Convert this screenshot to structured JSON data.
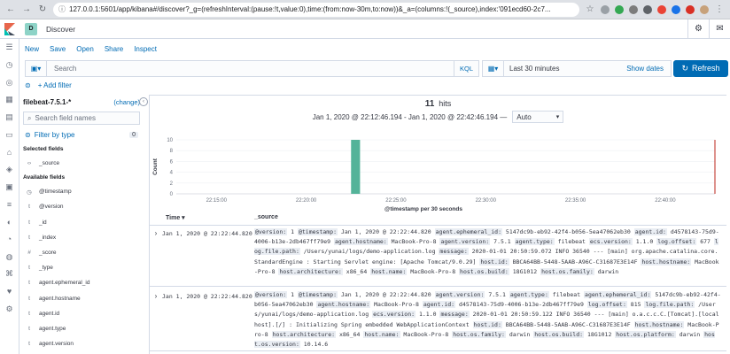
{
  "browser": {
    "url": "127.0.0.1:5601/app/kibana#/discover?_g=(refreshInterval:(pause:!t,value:0),time:(from:now-30m,to:now))&_a=(columns:!(_source),index:'091ecd60-2c7..."
  },
  "header": {
    "space_letter": "D",
    "breadcrumb": "Discover"
  },
  "top_menu": [
    "New",
    "Save",
    "Open",
    "Share",
    "Inspect"
  ],
  "query": {
    "placeholder": "Search",
    "kql": "KQL",
    "range": "Last 30 minutes",
    "show_dates": "Show dates",
    "refresh": "Refresh"
  },
  "filter": {
    "add": "+ Add filter"
  },
  "sidebar": {
    "index_pattern": "filebeat-7.5.1-*",
    "change": "(change)",
    "search_placeholder": "Search field names",
    "filter_by_type": "Filter by type",
    "filter_count": "0",
    "selected_heading": "Selected fields",
    "selected": [
      {
        "type": "‹›",
        "name": "_source"
      }
    ],
    "available_heading": "Available fields",
    "available": [
      {
        "type": "◷",
        "name": "@timestamp"
      },
      {
        "type": "t",
        "name": "@version"
      },
      {
        "type": "t",
        "name": "_id"
      },
      {
        "type": "t",
        "name": "_index"
      },
      {
        "type": "#",
        "name": "_score"
      },
      {
        "type": "t",
        "name": "_type"
      },
      {
        "type": "t",
        "name": "agent.ephemeral_id"
      },
      {
        "type": "t",
        "name": "agent.hostname"
      },
      {
        "type": "t",
        "name": "agent.id"
      },
      {
        "type": "t",
        "name": "agent.type"
      },
      {
        "type": "t",
        "name": "agent.version"
      }
    ]
  },
  "results": {
    "hits_count": "11",
    "hits_label": "hits",
    "time_range": "Jan 1, 2020 @ 22:12:46.194 - Jan 1, 2020 @ 22:42:46.194 —",
    "interval": "Auto"
  },
  "chart_data": {
    "type": "bar",
    "xlabel": "@timestamp per 30 seconds",
    "ylabel": "Count",
    "ylim": [
      0,
      10
    ],
    "yticks": [
      0,
      2,
      4,
      6,
      8,
      10
    ],
    "xticks": [
      "22:15:00",
      "22:20:00",
      "22:25:00",
      "22:30:00",
      "22:35:00",
      "22:40:00"
    ],
    "x_range": [
      "22:12:46",
      "22:42:46"
    ],
    "bars": [
      {
        "x": "22:22:30",
        "value": 11
      }
    ],
    "now_marker": "22:42:46",
    "color": "#54b399"
  },
  "table": {
    "col_time": "Time",
    "col_source": "_source",
    "rows": [
      {
        "time": "Jan 1, 2020 @ 22:22:44.820",
        "fields": [
          [
            "@version:",
            "1"
          ],
          [
            "@timestamp:",
            "Jan 1, 2020 @ 22:22:44.820"
          ],
          [
            "agent.ephemeral_id:",
            "5147dc9b-eb92-42f4-b056-5ea47062eb30"
          ],
          [
            "agent.id:",
            "d4578143-75d9-4006-b13e-2db467ff79e9"
          ],
          [
            "agent.hostname:",
            "MacBook-Pro-8"
          ],
          [
            "agent.version:",
            "7.5.1"
          ],
          [
            "agent.type:",
            "filebeat"
          ],
          [
            "ecs.version:",
            "1.1.0"
          ],
          [
            "log.offset:",
            "677"
          ],
          [
            "log.file.path:",
            "/Users/yunai/logs/demo-application.log"
          ],
          [
            "message:",
            "2020-01-01 20:50:59.072 INFO 36540 --- [main] org.apache.catalina.core.StandardEngine : Starting Servlet engine: [Apache Tomcat/9.0.29]"
          ],
          [
            "host.id:",
            "BBCA64BB-5448-5AAB-A96C-C31687E3E14F"
          ],
          [
            "host.hostname:",
            "MacBook-Pro-8"
          ],
          [
            "host.architecture:",
            "x86_64"
          ],
          [
            "host.name:",
            "MacBook-Pro-8"
          ],
          [
            "host.os.build:",
            "18G1012"
          ],
          [
            "host.os.family:",
            "darwin"
          ]
        ]
      },
      {
        "time": "Jan 1, 2020 @ 22:22:44.820",
        "fields": [
          [
            "@version:",
            "1"
          ],
          [
            "@timestamp:",
            "Jan 1, 2020 @ 22:22:44.820"
          ],
          [
            "agent.version:",
            "7.5.1"
          ],
          [
            "agent.type:",
            "filebeat"
          ],
          [
            "agent.ephemeral_id:",
            "5147dc9b-eb92-42f4-b056-5ea47062eb30"
          ],
          [
            "agent.hostname:",
            "MacBook-Pro-8"
          ],
          [
            "agent.id:",
            "d4578143-75d9-4006-b13e-2db467ff79e9"
          ],
          [
            "log.offset:",
            "815"
          ],
          [
            "log.file.path:",
            "/Users/yunai/logs/demo-application.log"
          ],
          [
            "ecs.version:",
            "1.1.0"
          ],
          [
            "message:",
            "2020-01-01 20:50:59.122 INFO 36540 --- [main] o.a.c.c.C.[Tomcat].[localhost].[/] : Initializing Spring embedded WebApplicationContext"
          ],
          [
            "host.id:",
            "BBCA64BB-5448-5AAB-A96C-C31687E3E14F"
          ],
          [
            "host.hostname:",
            "MacBook-Pro-8"
          ],
          [
            "host.architecture:",
            "x86_64"
          ],
          [
            "host.name:",
            "MacBook-Pro-8"
          ],
          [
            "host.os.family:",
            "darwin"
          ],
          [
            "host.os.build:",
            "18G1012"
          ],
          [
            "host.os.platform:",
            "darwin"
          ],
          [
            "host.os.version:",
            "10.14.6"
          ]
        ]
      }
    ]
  },
  "colors": {
    "accent": "#006bb4",
    "bar": "#54b399",
    "now_line": "#bd271e"
  }
}
